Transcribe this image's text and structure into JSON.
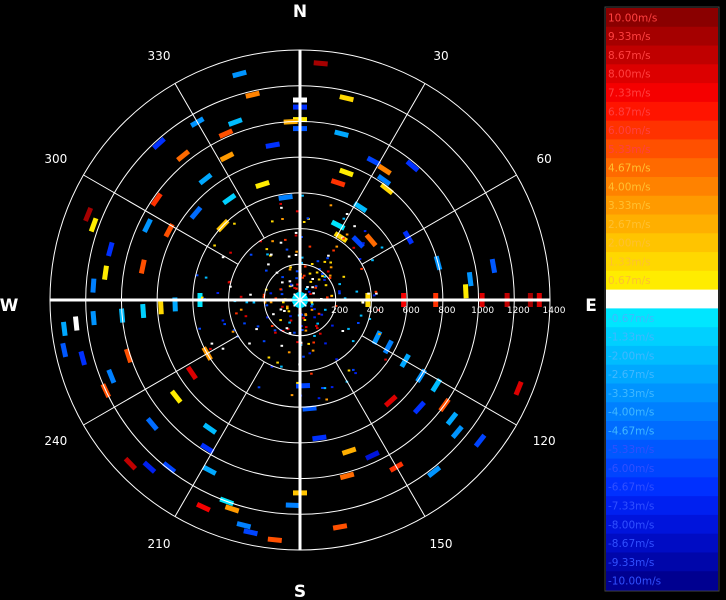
{
  "chart_data": {
    "type": "polar-scatter",
    "compass": {
      "north": "N",
      "east": "E",
      "south": "S",
      "west": "W"
    },
    "angle_labels": [
      {
        "deg": 30,
        "text": "30"
      },
      {
        "deg": 60,
        "text": "60"
      },
      {
        "deg": 120,
        "text": "120"
      },
      {
        "deg": 150,
        "text": "150"
      },
      {
        "deg": 210,
        "text": "210"
      },
      {
        "deg": 240,
        "text": "240"
      },
      {
        "deg": 300,
        "text": "300"
      },
      {
        "deg": 330,
        "text": "330"
      }
    ],
    "range_labels": [
      "200",
      "400",
      "600",
      "800",
      "1000",
      "1200",
      "1400"
    ],
    "colorbar": [
      {
        "label": "10.00m/s",
        "color": "#8a0000"
      },
      {
        "label": "9.33m/s",
        "color": "#a50000"
      },
      {
        "label": "8.67m/s",
        "color": "#c00000"
      },
      {
        "label": "8.00m/s",
        "color": "#dc0000"
      },
      {
        "label": "7.33m/s",
        "color": "#f50000"
      },
      {
        "label": "6.87m/s",
        "color": "#ff1400"
      },
      {
        "label": "6.00m/s",
        "color": "#ff3200"
      },
      {
        "label": "5.33m/s",
        "color": "#ff5000"
      },
      {
        "label": "4.67m/s",
        "color": "#ff6a00"
      },
      {
        "label": "4.00m/s",
        "color": "#ff8200"
      },
      {
        "label": "3.33m/s",
        "color": "#ff9a00"
      },
      {
        "label": "2.67m/s",
        "color": "#ffaf00"
      },
      {
        "label": "2.00m/s",
        "color": "#ffc400"
      },
      {
        "label": "1.33m/s",
        "color": "#ffd800"
      },
      {
        "label": "0.67m/s",
        "color": "#ffec00"
      },
      {
        "label": "0.00m/s",
        "color": "#ffffff"
      },
      {
        "label": "-0.67m/s",
        "color": "#00e6ff"
      },
      {
        "label": "-1.33m/s",
        "color": "#00d0ff"
      },
      {
        "label": "-2.00m/s",
        "color": "#00bcff"
      },
      {
        "label": "-2.67m/s",
        "color": "#00a8ff"
      },
      {
        "label": "-3.33m/s",
        "color": "#0094ff"
      },
      {
        "label": "-4.00m/s",
        "color": "#0080ff"
      },
      {
        "label": "-4.67m/s",
        "color": "#006cff"
      },
      {
        "label": "-5.33m/s",
        "color": "#0058ff"
      },
      {
        "label": "-6.00m/s",
        "color": "#0044ff"
      },
      {
        "label": "-6.67m/s",
        "color": "#0030ff"
      },
      {
        "label": "-7.33m/s",
        "color": "#0020f0"
      },
      {
        "label": "-8.00m/s",
        "color": "#0014dc"
      },
      {
        "label": "-8.67m/s",
        "color": "#000cc4"
      },
      {
        "label": "-9.33m/s",
        "color": "#0006aa"
      },
      {
        "label": "-10.00m/s",
        "color": "#000090"
      }
    ],
    "ring_count": 7,
    "range_max": 1400,
    "points": [
      {
        "az": 0,
        "range": 1120,
        "v": 0
      },
      {
        "az": 0,
        "range": 1080,
        "v": -6.67
      },
      {
        "az": 0,
        "range": 1010,
        "v": 0.67
      },
      {
        "az": 0,
        "range": 960,
        "v": -5.33
      },
      {
        "az": 5,
        "range": 1330,
        "v": 9.33
      },
      {
        "az": 13,
        "range": 1160,
        "v": 1.33
      },
      {
        "az": 14,
        "range": 960,
        "v": -2.67
      },
      {
        "az": 28,
        "range": 880,
        "v": -6.0
      },
      {
        "az": 33,
        "range": 870,
        "v": 4.0
      },
      {
        "az": 35,
        "range": 820,
        "v": -4.0
      },
      {
        "az": 38,
        "range": 790,
        "v": 1.33
      },
      {
        "az": 33,
        "range": 620,
        "v": -2.0
      },
      {
        "az": 40,
        "range": 980,
        "v": -6.67
      },
      {
        "az": 27,
        "range": 470,
        "v": -0.67
      },
      {
        "az": 33,
        "range": 420,
        "v": 1.33
      },
      {
        "az": 20,
        "range": 760,
        "v": 0.67
      },
      {
        "az": 18,
        "range": 690,
        "v": 6.0
      },
      {
        "az": 45,
        "range": 460,
        "v": -6.0
      },
      {
        "az": 50,
        "range": 520,
        "v": 4.67
      },
      {
        "az": 60,
        "range": 700,
        "v": -6.67
      },
      {
        "az": 75,
        "range": 800,
        "v": -3.33
      },
      {
        "az": 80,
        "range": 1100,
        "v": -5.33
      },
      {
        "az": 83,
        "range": 960,
        "v": -3.33
      },
      {
        "az": 87,
        "range": 930,
        "v": 0.67
      },
      {
        "az": 90,
        "range": 1020,
        "v": 8.0
      },
      {
        "az": 90,
        "range": 1160,
        "v": 8.67
      },
      {
        "az": 90,
        "range": 1290,
        "v": 9.33
      },
      {
        "az": 90,
        "range": 1340,
        "v": 8.0
      },
      {
        "az": 90,
        "range": 760,
        "v": 6.0
      },
      {
        "az": 90,
        "range": 580,
        "v": 7.33
      },
      {
        "az": 90,
        "range": 380,
        "v": 1.33
      },
      {
        "az": 116,
        "range": 480,
        "v": -3.33
      },
      {
        "az": 118,
        "range": 560,
        "v": -4.0
      },
      {
        "az": 120,
        "range": 680,
        "v": -2.67
      },
      {
        "az": 122,
        "range": 800,
        "v": -3.33
      },
      {
        "az": 122,
        "range": 900,
        "v": -2.0
      },
      {
        "az": 126,
        "range": 1000,
        "v": 5.33
      },
      {
        "az": 128,
        "range": 1080,
        "v": -2.67
      },
      {
        "az": 130,
        "range": 1150,
        "v": -3.33
      },
      {
        "az": 128,
        "range": 1280,
        "v": -6.0
      },
      {
        "az": 112,
        "range": 1320,
        "v": 8.0
      },
      {
        "az": 132,
        "range": 900,
        "v": -6.67
      },
      {
        "az": 138,
        "range": 760,
        "v": 8.0
      },
      {
        "az": 142,
        "range": 1220,
        "v": -3.33
      },
      {
        "az": 150,
        "range": 1080,
        "v": 6.0
      },
      {
        "az": 155,
        "range": 960,
        "v": -8.0
      },
      {
        "az": 162,
        "range": 890,
        "v": 2.67
      },
      {
        "az": 165,
        "range": 1020,
        "v": 4.67
      },
      {
        "az": 170,
        "range": 1290,
        "v": 5.33
      },
      {
        "az": 172,
        "range": 780,
        "v": -6.67
      },
      {
        "az": 175,
        "range": 610,
        "v": -5.33
      },
      {
        "az": 178,
        "range": 480,
        "v": -6.0
      },
      {
        "az": 180,
        "range": 1080,
        "v": 2.0
      },
      {
        "az": 182,
        "range": 1150,
        "v": -4.0
      },
      {
        "az": 186,
        "range": 1350,
        "v": 5.33
      },
      {
        "az": 192,
        "range": 1330,
        "v": -6.0
      },
      {
        "az": 194,
        "range": 1300,
        "v": -4.0
      },
      {
        "az": 198,
        "range": 1230,
        "v": 3.33
      },
      {
        "az": 200,
        "range": 1200,
        "v": -0.67
      },
      {
        "az": 205,
        "range": 1280,
        "v": 7.33
      },
      {
        "az": 208,
        "range": 1080,
        "v": -2.67
      },
      {
        "az": 212,
        "range": 980,
        "v": -6.67
      },
      {
        "az": 215,
        "range": 880,
        "v": -2.0
      },
      {
        "az": 218,
        "range": 1190,
        "v": -6.0
      },
      {
        "az": 222,
        "range": 1260,
        "v": -7.33
      },
      {
        "az": 226,
        "range": 1320,
        "v": 8.67
      },
      {
        "az": 230,
        "range": 1080,
        "v": -4.67
      },
      {
        "az": 232,
        "range": 880,
        "v": 0.67
      },
      {
        "az": 236,
        "range": 730,
        "v": 8.0
      },
      {
        "az": 240,
        "range": 600,
        "v": 3.33
      },
      {
        "az": 245,
        "range": 1200,
        "v": 5.33
      },
      {
        "az": 248,
        "range": 1140,
        "v": -4.0
      },
      {
        "az": 252,
        "range": 1010,
        "v": 5.33
      },
      {
        "az": 255,
        "range": 1260,
        "v": -6.67
      },
      {
        "az": 258,
        "range": 1350,
        "v": -5.33
      },
      {
        "az": 263,
        "range": 1330,
        "v": -2.67
      },
      {
        "az": 264,
        "range": 1260,
        "v": 0
      },
      {
        "az": 265,
        "range": 1160,
        "v": -3.33
      },
      {
        "az": 265,
        "range": 1000,
        "v": -2.0
      },
      {
        "az": 266,
        "range": 880,
        "v": -1.33
      },
      {
        "az": 267,
        "range": 780,
        "v": 1.33
      },
      {
        "az": 268,
        "range": 700,
        "v": -2.67
      },
      {
        "az": 270,
        "range": 560,
        "v": -0.67
      },
      {
        "az": 274,
        "range": 1160,
        "v": -4.0
      },
      {
        "az": 278,
        "range": 1100,
        "v": 0.67
      },
      {
        "az": 282,
        "range": 900,
        "v": 5.33
      },
      {
        "az": 285,
        "range": 1100,
        "v": -6.67
      },
      {
        "az": 290,
        "range": 1230,
        "v": 0.67
      },
      {
        "az": 292,
        "range": 1280,
        "v": 9.33
      },
      {
        "az": 296,
        "range": 950,
        "v": -3.33
      },
      {
        "az": 298,
        "range": 830,
        "v": 5.33
      },
      {
        "az": 305,
        "range": 980,
        "v": 6.0
      },
      {
        "az": 310,
        "range": 760,
        "v": -4.67
      },
      {
        "az": 314,
        "range": 600,
        "v": 2.0
      },
      {
        "az": 318,
        "range": 1180,
        "v": -6.67
      },
      {
        "az": 321,
        "range": 1040,
        "v": 4.67
      },
      {
        "az": 322,
        "range": 860,
        "v": -2.67
      },
      {
        "az": 325,
        "range": 690,
        "v": -1.33
      },
      {
        "az": 330,
        "range": 1150,
        "v": -3.33
      },
      {
        "az": 333,
        "range": 900,
        "v": 3.33
      },
      {
        "az": 336,
        "range": 1020,
        "v": 5.33
      },
      {
        "az": 340,
        "range": 1060,
        "v": -2.0
      },
      {
        "az": 342,
        "range": 680,
        "v": 0.67
      },
      {
        "az": 345,
        "range": 1310,
        "v": -3.33
      },
      {
        "az": 347,
        "range": 1180,
        "v": 4.0
      },
      {
        "az": 350,
        "range": 880,
        "v": -6.67
      },
      {
        "az": 352,
        "range": 580,
        "v": -4.0
      },
      {
        "az": 357,
        "range": 1000,
        "v": 2.67
      }
    ]
  }
}
